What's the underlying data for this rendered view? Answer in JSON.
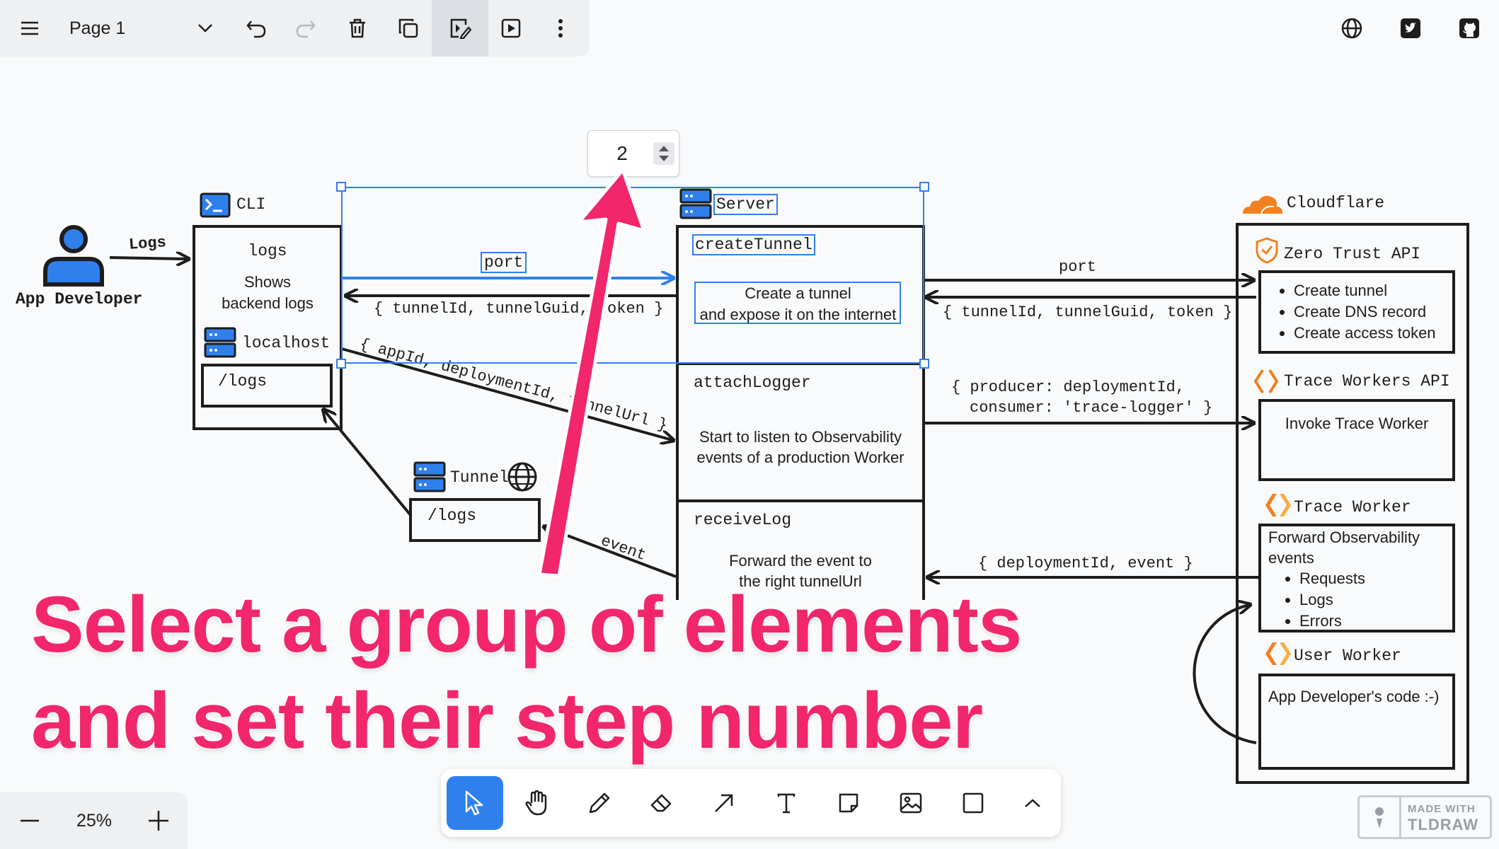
{
  "topbar": {
    "page_name": "Page 1",
    "social": [
      "globe-icon",
      "twitter-icon",
      "github-icon"
    ]
  },
  "step_input": {
    "value": "2"
  },
  "diagram": {
    "actor_label": "App Developer",
    "logs_arrow_label": "Logs",
    "cli": {
      "title": "CLI",
      "logs_heading": "logs",
      "logs_desc_line1": "Shows",
      "logs_desc_line2": "backend logs",
      "localhost": "localhost",
      "logs_path": "/logs"
    },
    "tunnel": {
      "title": "Tunnel",
      "path": "/logs"
    },
    "server": {
      "title": "Server",
      "create_tunnel": "createTunnel",
      "create_desc_line1": "Create a tunnel",
      "create_desc_line2": "and expose it on the internet",
      "attach_logger": "attachLogger",
      "attach_desc_line1": "Start to listen to Observability",
      "attach_desc_line2": "events of a production Worker",
      "receive_log": "receiveLog",
      "receive_desc_line1": "Forward the event to",
      "receive_desc_line2": "the right tunnelUrl"
    },
    "arrows": {
      "port_left": "port",
      "tunnel_info_left": "{ tunnelId, tunnelGuid, token }",
      "app_id_diag": "{ appId, deploymentId, tunnelUrl }",
      "event": "event",
      "port_right": "port",
      "tunnel_info_right": "{ tunnelId, tunnelGuid, token }",
      "producer_line1": "{ producer: deploymentId,",
      "producer_line2": "consumer: 'trace-logger' }",
      "deployment_event": "{ deploymentId, event }"
    },
    "cloudflare": {
      "title": "Cloudflare",
      "zero_trust_title": "Zero Trust API",
      "zero_trust_items": [
        "Create tunnel",
        "Create DNS record",
        "Create access token"
      ],
      "trace_api_title": "Trace Workers API",
      "trace_api_desc": "Invoke Trace Worker",
      "trace_worker_title": "Trace Worker",
      "trace_worker_desc_line1": "Forward Observability",
      "trace_worker_desc_line2": "events",
      "trace_worker_items": [
        "Requests",
        "Logs",
        "Errors"
      ],
      "user_worker_title": "User Worker",
      "user_worker_desc": "App Developer's code :-)"
    }
  },
  "caption": {
    "line1": "Select a group of elements",
    "line2": "and set their step number"
  },
  "zoom": {
    "level": "25%"
  },
  "tools": [
    "select",
    "hand",
    "draw",
    "eraser",
    "arrow",
    "text",
    "note",
    "image",
    "rectangle",
    "more"
  ],
  "badge": {
    "line1": "MADE WITH",
    "line2": "TLDRAW"
  },
  "colors": {
    "accent": "#2f80ed",
    "caption": "#f2266b",
    "cloudflare": "#f38020",
    "tool_active": "#2f80ed"
  }
}
